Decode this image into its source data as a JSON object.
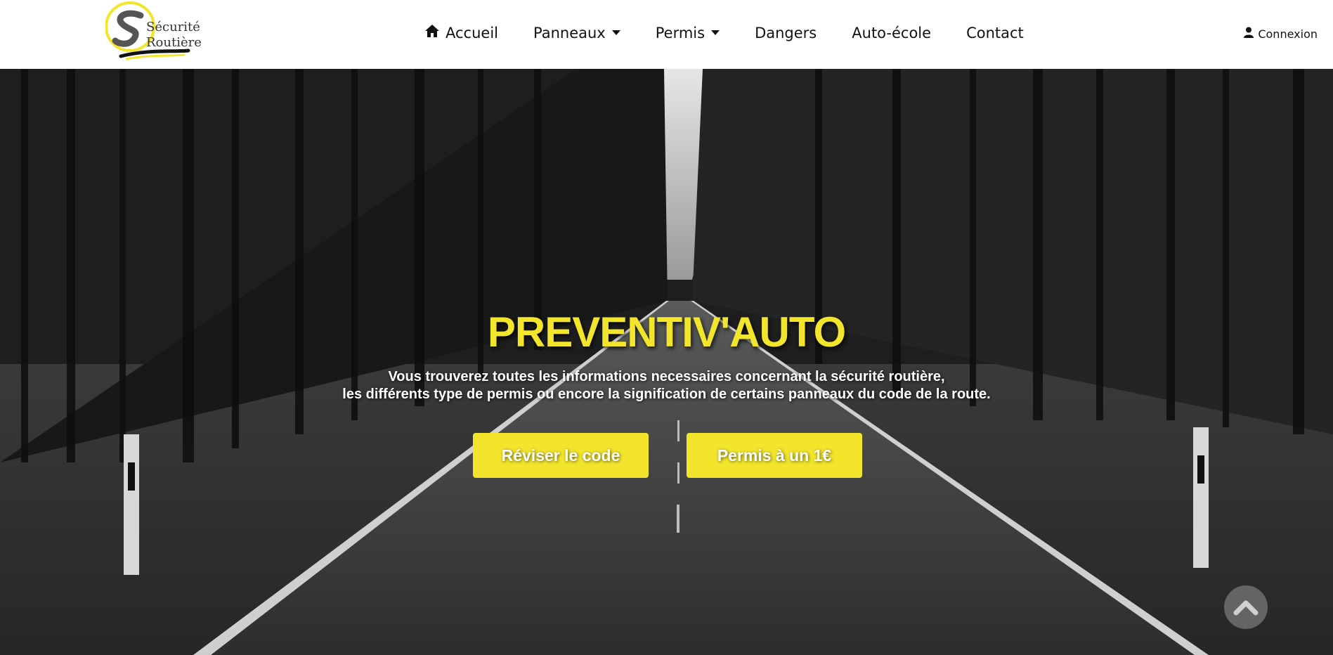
{
  "logo": {
    "line1": "Sécurité",
    "line2": "Routière"
  },
  "nav": {
    "items": [
      {
        "label": "Accueil",
        "icon": "home-icon"
      },
      {
        "label": "Panneaux",
        "dropdown": true
      },
      {
        "label": "Permis",
        "dropdown": true
      },
      {
        "label": "Dangers"
      },
      {
        "label": "Auto-école"
      },
      {
        "label": "Contact"
      }
    ],
    "login": {
      "label": "Connexion",
      "icon": "user-icon"
    }
  },
  "hero": {
    "title": "PREVENTIV'AUTO",
    "subtitle_line1": "Vous trouverez toutes les informations necessaires concernant la sécurité routière,",
    "subtitle_line2": "les différents type de permis ou encore la signification de certains panneaux du code de la route.",
    "buttons": {
      "review_code": "Réviser le code",
      "permis": "Permis à un 1€"
    }
  },
  "colors": {
    "accent": "#f2e52c",
    "nav_bg": "#ffffff",
    "text": "#111111"
  },
  "scroll_top": {
    "icon": "chevron-up-icon"
  }
}
